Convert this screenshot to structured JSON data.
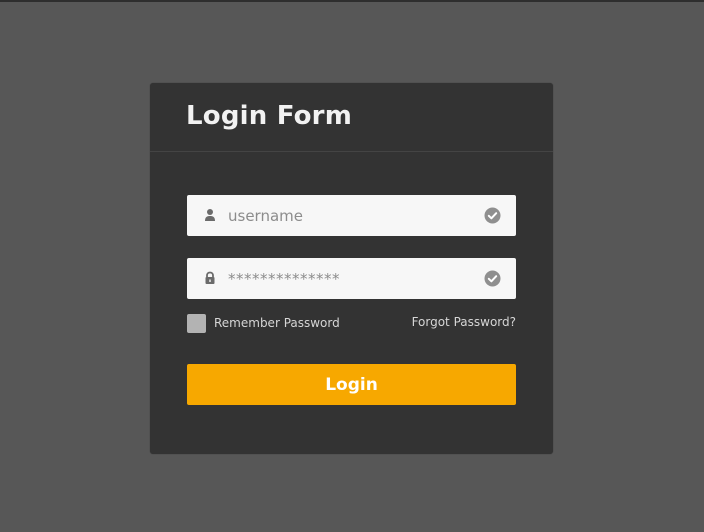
{
  "form": {
    "title": "Login Form",
    "username": {
      "placeholder": "username",
      "icon": "user-icon",
      "status_icon": "check-circle-icon"
    },
    "password": {
      "masked_value": "**************",
      "icon": "lock-icon",
      "status_icon": "check-circle-icon"
    },
    "remember_label": "Remember Password",
    "remember_checked": false,
    "forgot_label": "Forgot Password?",
    "submit_label": "Login"
  },
  "colors": {
    "page_background": "#575757",
    "card_background": "#333333",
    "accent": "#f7a800",
    "field_background": "#f7f7f7"
  }
}
